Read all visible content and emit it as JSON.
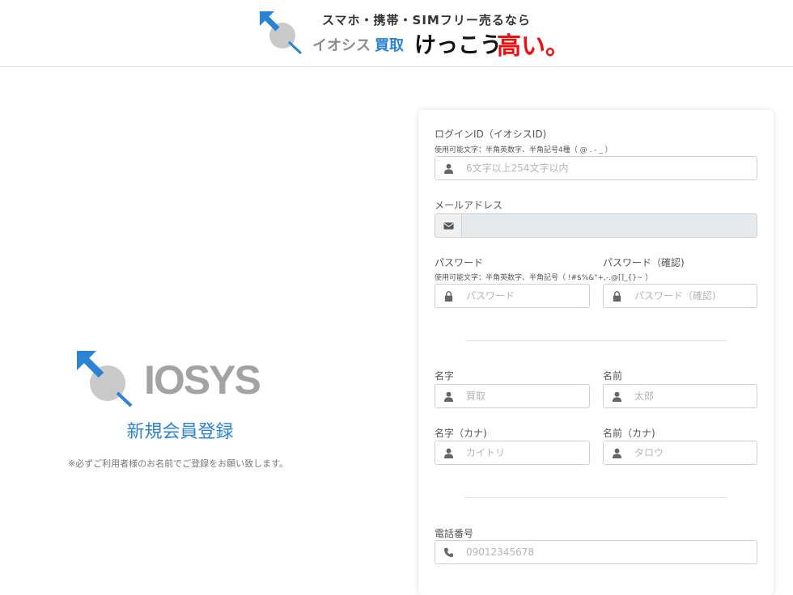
{
  "header": {
    "tagline": "スマホ・携帯・SIMフリー売るなら",
    "brand_kana": "イオシス",
    "brand_kaitori": "買取",
    "brand_kekkou": "けっこう",
    "brand_takai": "高い。"
  },
  "left": {
    "logo_text": "IOSYS",
    "title": "新規会員登録",
    "note": "※必ずご利用者様のお名前でご登録をお願い致します。"
  },
  "form": {
    "login_id": {
      "label": "ログインID（イオシスID)",
      "hint": "使用可能文字：半角英数字、半角記号4種（ @ . - _ ）",
      "placeholder": "6文字以上254文字以内"
    },
    "email": {
      "label": "メールアドレス",
      "value": ""
    },
    "password": {
      "label": "パスワード",
      "hint": "使用可能文字：半角英数字、半角記号（ !#$%&\"+,-.@[]_{}~ ）",
      "placeholder": "パスワード"
    },
    "password_confirm": {
      "label": "パスワード（確認)",
      "placeholder": "パスワード（確認)"
    },
    "last_name": {
      "label": "名字",
      "placeholder": "買取"
    },
    "first_name": {
      "label": "名前",
      "placeholder": "太郎"
    },
    "last_name_kana": {
      "label": "名字（カナ)",
      "placeholder": "カイトリ"
    },
    "first_name_kana": {
      "label": "名前（カナ)",
      "placeholder": "タロウ"
    },
    "phone": {
      "label": "電話番号",
      "placeholder": "09012345678"
    }
  },
  "colors": {
    "accent": "#2a83d4",
    "highlight": "#e11111",
    "logo_gray": "#a3a3a3"
  }
}
